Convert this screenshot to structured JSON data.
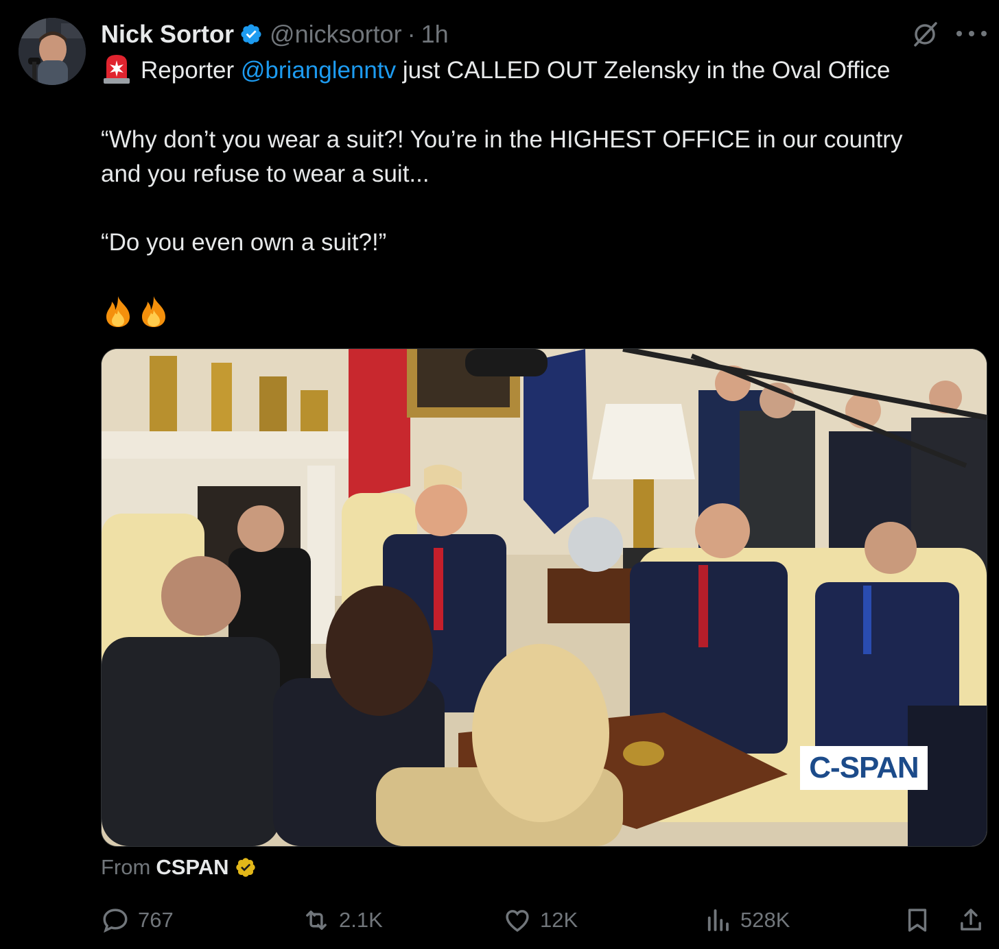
{
  "tweet": {
    "author": {
      "display_name": "Nick Sortor",
      "handle": "@nicksortor",
      "separator": "·",
      "time": "1h",
      "verified": true
    },
    "text": {
      "line1_prefix": "Reporter",
      "mention": "@brianglenntv",
      "line1_suffix": "just CALLED OUT Zelensky in the Oval Office",
      "quote1_line1": "“Why don’t you wear a suit?! You’re in the HIGHEST OFFICE in our country",
      "quote1_line2": "and you refuse to wear a suit...",
      "quote2": "“Do you even own a suit?!”",
      "emoji_icons": [
        "fire-icon",
        "fire-icon"
      ],
      "lead_icon": "siren-icon"
    },
    "media": {
      "watermark": "C-SPAN"
    },
    "source": {
      "prefix": "From",
      "name": "CSPAN"
    },
    "actions": {
      "replies": "767",
      "reposts": "2.1K",
      "likes": "12K",
      "views": "528K"
    }
  },
  "colors": {
    "background": "#000000",
    "text": "#e7e9ea",
    "secondary": "#71767b",
    "link": "#1d9bf0",
    "verified_blue": "#1d9bf0",
    "verified_gold": "#e2b719"
  },
  "icons": [
    "grok-icon",
    "more-icon",
    "reply-icon",
    "repost-icon",
    "like-icon",
    "views-icon",
    "bookmark-icon",
    "share-icon"
  ]
}
